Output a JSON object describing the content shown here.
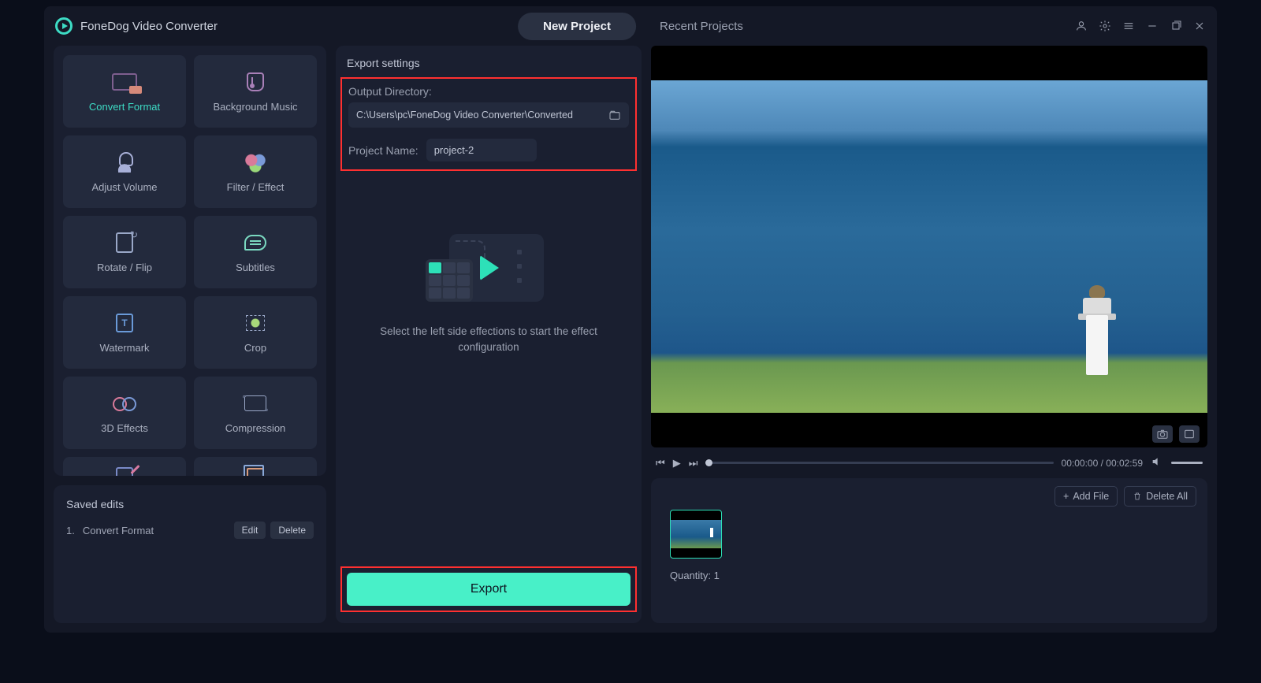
{
  "app_title": "FoneDog Video Converter",
  "tabs": {
    "new_project": "New Project",
    "recent_projects": "Recent Projects"
  },
  "tools": {
    "convert_format": "Convert Format",
    "background_music": "Background Music",
    "adjust_volume": "Adjust Volume",
    "filter_effect": "Filter / Effect",
    "rotate_flip": "Rotate / Flip",
    "subtitles": "Subtitles",
    "watermark": "Watermark",
    "crop": "Crop",
    "threeD_effects": "3D Effects",
    "compression": "Compression"
  },
  "saved_edits": {
    "heading": "Saved edits",
    "items": [
      {
        "index": "1.",
        "name": "Convert Format"
      }
    ],
    "edit_btn": "Edit",
    "delete_btn": "Delete"
  },
  "export_settings": {
    "heading": "Export settings",
    "output_dir_label": "Output Directory:",
    "output_dir_value": "C:\\Users\\pc\\FoneDog Video Converter\\Converted",
    "project_name_label": "Project Name:",
    "project_name_value": "project-2",
    "hint": "Select the left side effections to start the effect configuration",
    "export_btn": "Export"
  },
  "playback": {
    "current_time": "00:00:00",
    "total_time": "00:02:59",
    "separator": " / "
  },
  "files": {
    "add_file_btn": "Add File",
    "delete_all_btn": "Delete All",
    "quantity_label": "Quantity: ",
    "quantity_value": "1"
  }
}
